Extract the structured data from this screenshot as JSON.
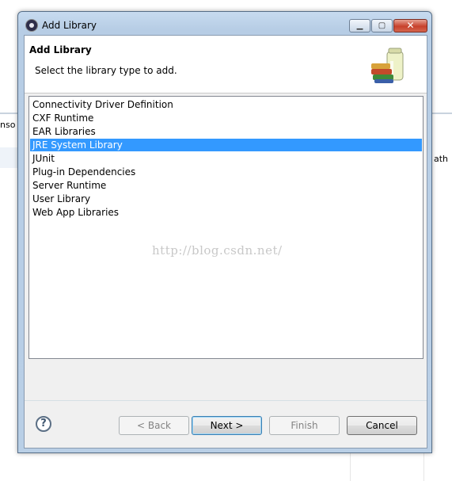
{
  "background": {
    "left_tab_label": "nso",
    "right_column_label": "ath"
  },
  "window": {
    "title": "Add Library",
    "icon": "eclipse-icon",
    "minimize_glyph": "▁",
    "maximize_glyph": "▢",
    "close_glyph": "✕"
  },
  "header": {
    "title": "Add Library",
    "description": "Select the library type to add.",
    "image": "library-jars-icon"
  },
  "library_types": [
    {
      "label": "Connectivity Driver Definition",
      "selected": false
    },
    {
      "label": "CXF Runtime",
      "selected": false
    },
    {
      "label": "EAR Libraries",
      "selected": false
    },
    {
      "label": "JRE System Library",
      "selected": true
    },
    {
      "label": "JUnit",
      "selected": false
    },
    {
      "label": "Plug-in Dependencies",
      "selected": false
    },
    {
      "label": "Server Runtime",
      "selected": false
    },
    {
      "label": "User Library",
      "selected": false
    },
    {
      "label": "Web App Libraries",
      "selected": false
    }
  ],
  "watermark": "http://blog.csdn.net/",
  "buttons": {
    "help_glyph": "?",
    "back": "< Back",
    "next": "Next >",
    "finish": "Finish",
    "cancel": "Cancel"
  },
  "colors": {
    "selection": "#3399ff",
    "dialog_frame": "#b9cfe6"
  }
}
